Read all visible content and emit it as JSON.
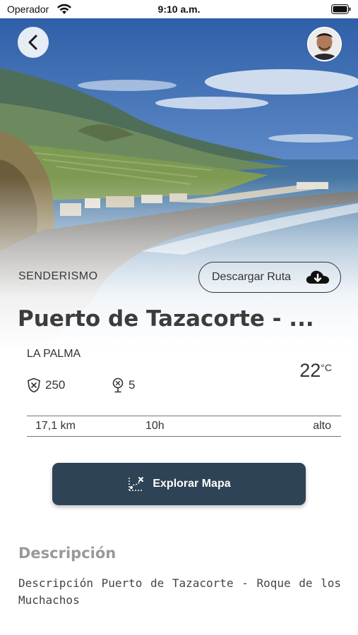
{
  "status_bar": {
    "carrier": "Operador",
    "time": "9:10 a.m."
  },
  "header": {
    "back_icon": "chevron-left-icon",
    "avatar_icon": "user-avatar"
  },
  "route": {
    "category": "SENDERISMO",
    "download_label": "Descargar Ruta",
    "download_icon": "cloud-download-icon",
    "title": "Puerto de Tazacorte - ...",
    "region": "LA PALMA",
    "stat_points": "250",
    "stat_points_icon": "shield-icon",
    "stat_pins": "5",
    "stat_pins_icon": "map-pin-icon",
    "temperature": "22",
    "temperature_unit": "°C",
    "distance": "17,1 km",
    "duration": "10h",
    "difficulty": "alto"
  },
  "actions": {
    "explore_label": "Explorar Mapa",
    "explore_icon": "map-route-icon"
  },
  "description": {
    "heading": "Descripción",
    "text": "Descripción Puerto de Tazacorte - Roque de los Muchachos"
  },
  "colors": {
    "primary_button": "#2e4355",
    "sky": "#5b86c4",
    "sea": "#5e8fb8"
  }
}
